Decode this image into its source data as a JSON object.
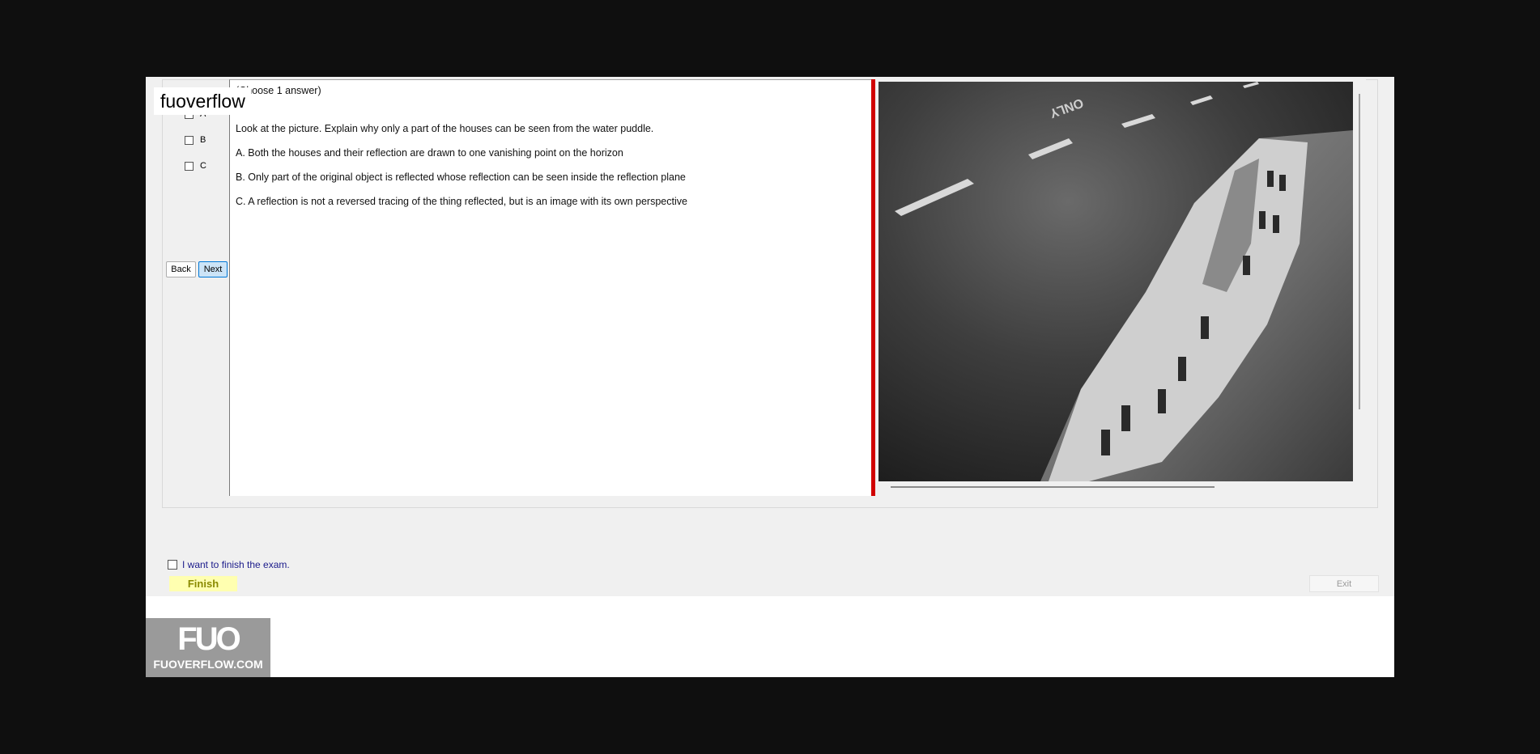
{
  "watermark": "fuoverflow",
  "header": {
    "choose_text": "(Choose 1 answer)"
  },
  "answer_options": [
    {
      "label": "A"
    },
    {
      "label": "B"
    },
    {
      "label": "C"
    }
  ],
  "nav": {
    "back_label": "Back",
    "next_label": "Next"
  },
  "question": {
    "prompt": "Look at the picture. Explain why only a part of the houses can be seen from the water puddle.",
    "choices": [
      "A.  Both the houses and their reflection are drawn to one vanishing point on the horizon",
      "B.  Only part of the original object is reflected whose reflection can be seen inside the reflection plane",
      "C.  A reflection is not a reversed tracing of the thing reflected, but is an image with its own perspective"
    ]
  },
  "image": {
    "road_text": "ONLY"
  },
  "footer": {
    "finish_check_label": "I want to finish the exam.",
    "finish_label": "Finish",
    "exit_label": "Exit"
  },
  "logo": {
    "mark": "FUO",
    "site": "FUOVERFLOW.COM"
  },
  "colors": {
    "accent_red": "#d00000",
    "finish_yellow": "#ffffb0",
    "next_blue": "#cce4f7"
  }
}
